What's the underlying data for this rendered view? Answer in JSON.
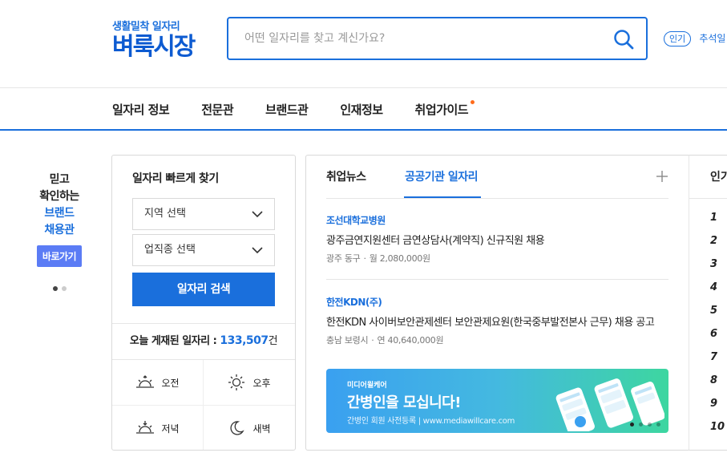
{
  "logo": {
    "sub": "생활밀착 일자리",
    "main": "벼룩시장"
  },
  "search": {
    "placeholder": "어떤 일자리를 찾고 계신가요?"
  },
  "popular": {
    "badge": "인기",
    "text": "추석일"
  },
  "gnb": [
    "일자리 정보",
    "전문관",
    "브랜드관",
    "인재정보",
    "취업가이드"
  ],
  "brand": {
    "lines": [
      "믿고",
      "확인하는",
      "브랜드",
      "채용관"
    ],
    "button": "바로가기"
  },
  "quick": {
    "title": "일자리 빠르게 찾기",
    "region": "지역 선택",
    "category": "업직종 선택",
    "submit": "일자리 검색",
    "today_label": "오늘 게재된 일자리 :",
    "today_count": "133,507",
    "today_unit": "건",
    "times": [
      "오전",
      "오후",
      "저녁",
      "새벽"
    ]
  },
  "news": {
    "tabs": [
      "취업뉴스",
      "공공기관 일자리"
    ],
    "jobs": [
      {
        "company": "조선대학교병원",
        "title": "광주금연지원센터 금연상담사(계약직) 신규직원 채용",
        "location": "광주 동구",
        "pay": "월 2,080,000원"
      },
      {
        "company": "한전KDN(주)",
        "title": "한전KDN 사이버보안관제센터 보안관제요원(한국중부발전본사 근무) 채용 공고",
        "location": "충남 보령시",
        "pay": "연 40,640,000원"
      }
    ],
    "ad": {
      "brand": "미디어윌케어",
      "title": "간병인을 모십니다!",
      "sub": "간병인 회원 사전등록 | www.mediawillcare.com"
    }
  },
  "rank": {
    "title": "인기",
    "numbers": [
      "1",
      "2",
      "3",
      "4",
      "5",
      "6",
      "7",
      "8",
      "9",
      "10"
    ]
  },
  "colors": {
    "primary": "#1a6fdc",
    "accent_dot": "#ff6b1a",
    "brand_button": "#5b7cf5"
  }
}
